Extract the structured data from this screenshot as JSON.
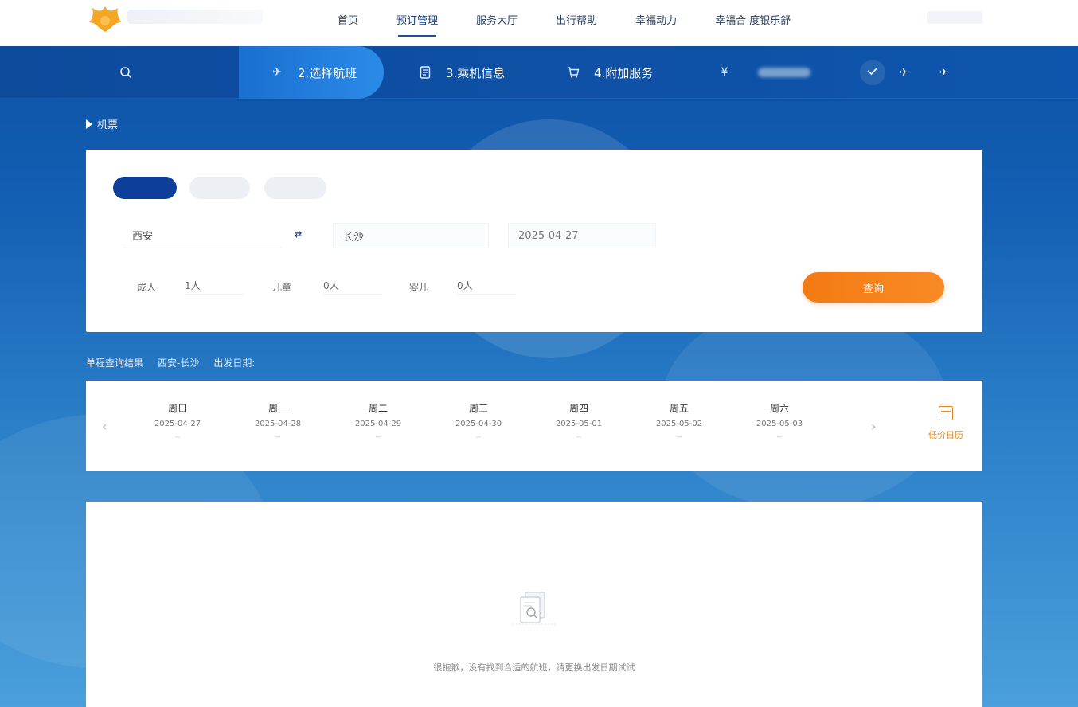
{
  "nav": {
    "items": [
      {
        "label": "首页"
      },
      {
        "label": "预订管理"
      },
      {
        "label": "服务大厅"
      },
      {
        "label": "出行帮助"
      },
      {
        "label": "幸福动力"
      },
      {
        "label": "幸福合 度银乐舒"
      }
    ],
    "active_index": 1
  },
  "steps": {
    "step2": "2.选择航班",
    "step3": "3.乘机信息",
    "step4": "4.附加服务",
    "step5_icon": "¥"
  },
  "breadcrumb": "机票",
  "search": {
    "from": "西安",
    "to": "长沙",
    "date": "2025-04-27",
    "swap_symbol": "⇄",
    "adult_label": "成人",
    "adult_value": "1人",
    "child_label": "儿童",
    "child_value": "0人",
    "infant_label": "婴儿",
    "infant_value": "0人",
    "search_button": "查询"
  },
  "route_info": {
    "title": "单程查询结果",
    "route": "西安-长沙",
    "date_label": "出发日期:"
  },
  "date_strip": {
    "days": [
      {
        "weekday": "周日",
        "date": "2025-04-27",
        "price": "--"
      },
      {
        "weekday": "周一",
        "date": "2025-04-28",
        "price": "--"
      },
      {
        "weekday": "周二",
        "date": "2025-04-29",
        "price": "--"
      },
      {
        "weekday": "周三",
        "date": "2025-04-30",
        "price": "--"
      },
      {
        "weekday": "周四",
        "date": "2025-05-01",
        "price": "--"
      },
      {
        "weekday": "周五",
        "date": "2025-05-02",
        "price": "--"
      },
      {
        "weekday": "周六",
        "date": "2025-05-03",
        "price": "--"
      }
    ],
    "calendar_label": "低价日历",
    "prev_symbol": "‹",
    "next_symbol": "›"
  },
  "results": {
    "empty_message": "很抱歉，没有找到合适的航班，请更换出发日期试试"
  },
  "colors": {
    "brand_blue": "#0d3f9a",
    "accent_orange": "#f47a12"
  }
}
